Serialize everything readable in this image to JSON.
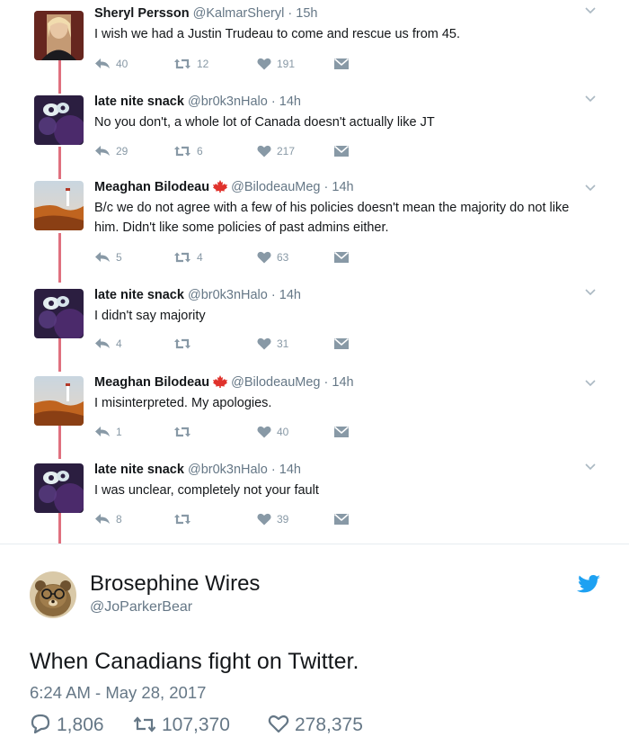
{
  "colors": {
    "thread_line": "#e0707f",
    "text": "#14171a",
    "secondary": "#657786",
    "action_gray": "#8899a6",
    "twitter_blue": "#1da1f2",
    "flag_red": "#e0322c"
  },
  "thread": [
    {
      "name": "Sheryl Persson",
      "handle": "@KalmarSheryl",
      "separator": "·",
      "time": "15h",
      "flag": false,
      "avatar": "portrait-avatar",
      "text": "I wish we had a Justin Trudeau to come and rescue us from 45.",
      "replies": "40",
      "retweets": "12",
      "likes": "191"
    },
    {
      "name": "late nite snack",
      "handle": "@br0k3nHalo",
      "separator": "·",
      "time": "14h",
      "flag": false,
      "avatar": "blurry-purple-avatar",
      "text": "No you don't, a whole lot of Canada doesn't actually like JT",
      "replies": "29",
      "retweets": "6",
      "likes": "217"
    },
    {
      "name": "Meaghan Bilodeau",
      "handle": "@BilodeauMeg",
      "separator": "·",
      "time": "14h",
      "flag": true,
      "avatar": "landscape-avatar",
      "text": "B/c we do not agree with a few of his policies doesn't mean the majority do not like him. Didn't like some policies of past admins either.",
      "replies": "5",
      "retweets": "4",
      "likes": "63"
    },
    {
      "name": "late nite snack",
      "handle": "@br0k3nHalo",
      "separator": "·",
      "time": "14h",
      "flag": false,
      "avatar": "blurry-purple-avatar",
      "text": "I didn't say majority",
      "replies": "4",
      "retweets": "",
      "likes": "31"
    },
    {
      "name": "Meaghan Bilodeau",
      "handle": "@BilodeauMeg",
      "separator": "·",
      "time": "14h",
      "flag": true,
      "avatar": "landscape-avatar",
      "text": "I misinterpreted. My apologies.",
      "replies": "1",
      "retweets": "",
      "likes": "40"
    },
    {
      "name": "late nite snack",
      "handle": "@br0k3nHalo",
      "separator": "·",
      "time": "14h",
      "flag": false,
      "avatar": "blurry-purple-avatar",
      "text": "I was unclear, completely not your fault",
      "replies": "8",
      "retweets": "",
      "likes": "39"
    }
  ],
  "main_tweet": {
    "name": "Brosephine Wires",
    "handle": "@JoParkerBear",
    "text": "When Canadians fight on Twitter.",
    "timestamp": "6:24 AM - May 28, 2017",
    "replies": "1,806",
    "retweets": "107,370",
    "likes": "278,375",
    "avatar": "bear-with-glasses-avatar",
    "logo": "twitter-bird-icon"
  }
}
